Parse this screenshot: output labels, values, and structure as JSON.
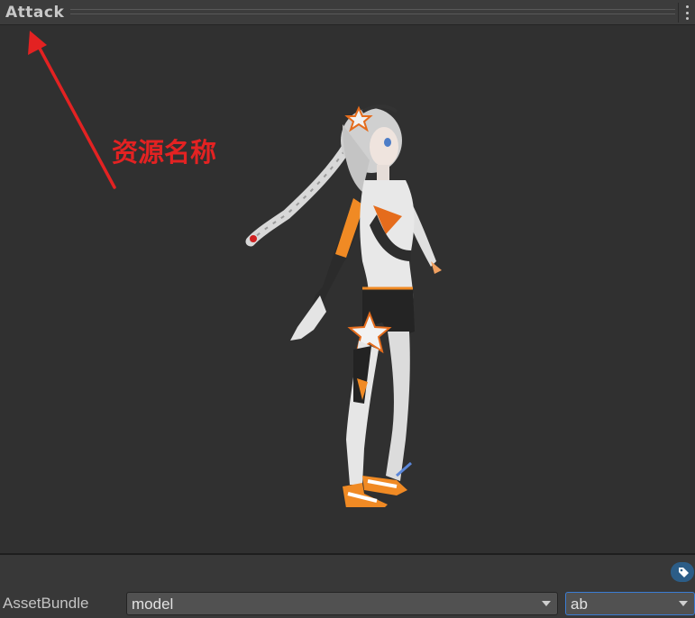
{
  "header": {
    "title": "Attack",
    "menu_icon": "kebab-menu-icon"
  },
  "preview": {
    "annotation_text": "资源名称",
    "annotation_color": "#e32222",
    "background_color": "#303030"
  },
  "footer": {
    "tag_icon": "tag-icon",
    "tag_icon_color": "#2c5d87",
    "assetbundle_label": "AssetBundle",
    "assetbundle_name": "model",
    "assetbundle_variant": "ab"
  }
}
